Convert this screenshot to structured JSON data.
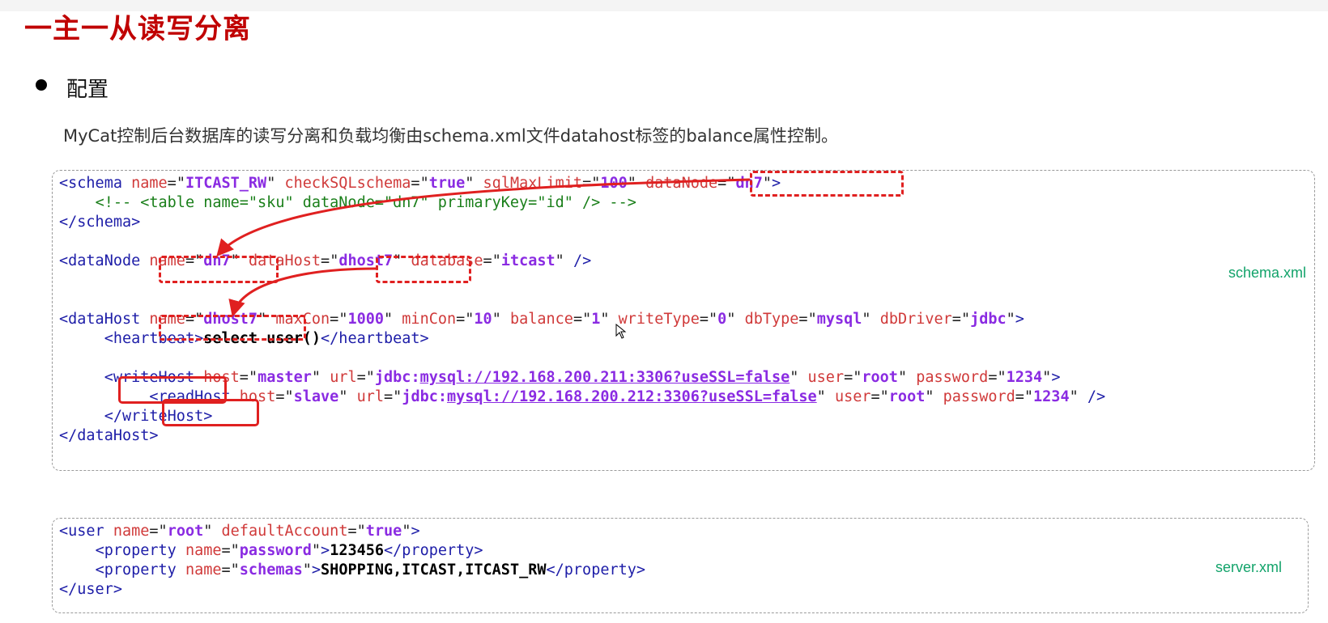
{
  "title": "一主一从读写分离",
  "bullet": "配置",
  "description": "MyCat控制后台数据库的读写分离和负载均衡由schema.xml文件datahost标签的balance属性控制。",
  "schema_file_label": "schema.xml",
  "server_file_label": "server.xml",
  "schema_code": {
    "schema_name": "ITCAST_RW",
    "checkSQLschema": "true",
    "sqlMaxLimit": "100",
    "schema_dataNode": "dn7",
    "comment": "<!-- <table name=\"sku\" dataNode=\"dn7\" primaryKey=\"id\" /> -->",
    "dataNode_name": "dn7",
    "dataNode_dataHost": "dhost7",
    "dataNode_database": "itcast",
    "dataHost_name": "dhost7",
    "maxCon": "1000",
    "minCon": "10",
    "balance": "1",
    "writeType": "0",
    "dbType": "mysql",
    "dbDriver": "jdbc",
    "heartbeat": "select user()",
    "write_host": "master",
    "write_url_prefix": "jdbc:",
    "write_url": "mysql://192.168.200.211:3306?useSSL=false",
    "write_user": "root",
    "write_password": "1234",
    "read_host": "slave",
    "read_url_prefix": "jdbc:",
    "read_url": "mysql://192.168.200.212:3306?useSSL=false",
    "read_user": "root",
    "read_password": "1234"
  },
  "server_code": {
    "user_name": "root",
    "defaultAccount": "true",
    "prop1_name": "password",
    "prop1_value": "123456",
    "prop2_name": "schemas",
    "prop2_value": "SHOPPING,ITCAST,ITCAST_RW"
  },
  "colors": {
    "title": "#c00000",
    "highlight": "#e02020",
    "tag": "#1e1ea8",
    "attr": "#d03a3a",
    "value": "#8a2be2",
    "comment": "#1a7f1a",
    "file_label": "#12a36a"
  }
}
